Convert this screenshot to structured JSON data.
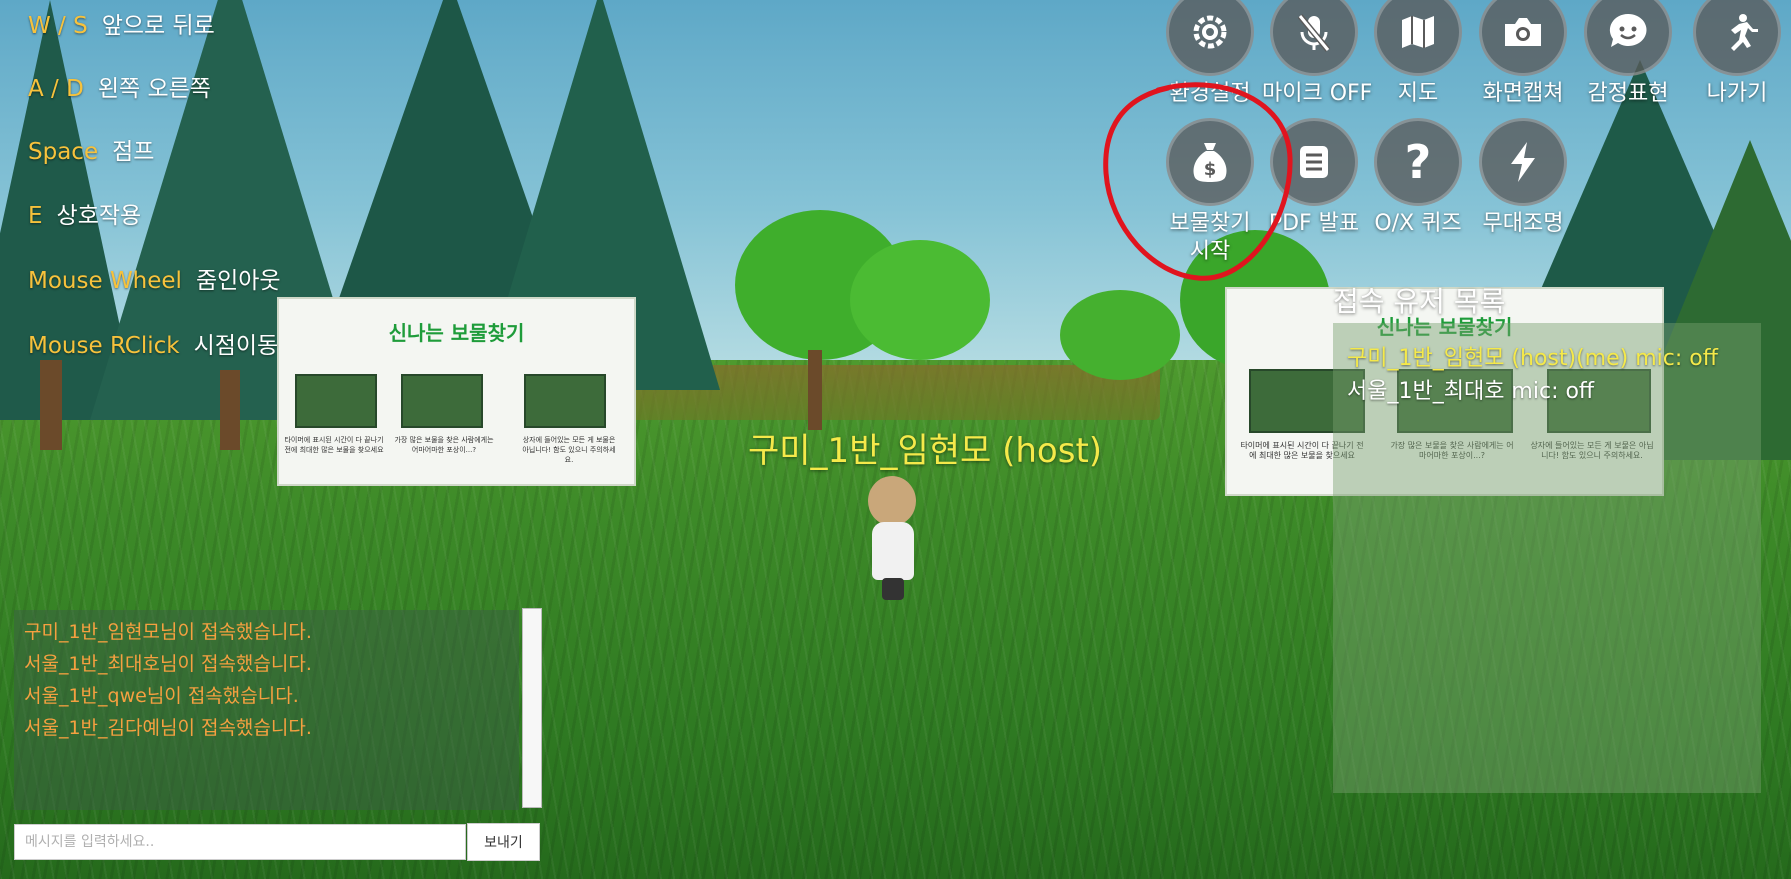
{
  "controls": [
    {
      "key": "W / S",
      "action": "앞으로 뒤로"
    },
    {
      "key": "A / D",
      "action": "왼쪽 오른쪽"
    },
    {
      "key": "Space",
      "action": "점프"
    },
    {
      "key": "E",
      "action": "상호작용"
    },
    {
      "key": "Mouse Wheel",
      "action": "줌인아웃"
    },
    {
      "key": "Mouse RClick",
      "action": "시점이동"
    }
  ],
  "toolbar": {
    "row1": [
      {
        "label": "환경설정",
        "icon": "settings-gear-icon"
      },
      {
        "label": "마이크 OFF",
        "icon": "mic-off-icon"
      },
      {
        "label": "지도",
        "icon": "map-icon"
      },
      {
        "label": "화면캡쳐",
        "icon": "camera-icon"
      },
      {
        "label": "감정표현",
        "icon": "emoji-chat-icon"
      },
      {
        "label": "나가기",
        "icon": "running-exit-icon"
      }
    ],
    "row2": [
      {
        "label": "보물찾기 시작",
        "icon": "money-bag-icon"
      },
      {
        "label": "PDF 발표",
        "icon": "document-list-icon"
      },
      {
        "label": "O/X 퀴즈",
        "icon": "question-mark-icon"
      },
      {
        "label": "무대조명",
        "icon": "lightning-icon"
      }
    ]
  },
  "scene": {
    "billboard_title": "신나는 보물찾기",
    "billboard_captions": [
      "타이머에 표시된 시간이 다 끝나기 전에 최대한 많은 보물을 찾으세요",
      "가장 많은 보물을 찾은 사람에게는 어마어마한 포상이...?",
      "상자에 들어있는 모든 게 보물은 아닙니다! 함도 있으니 주의하세요."
    ],
    "player_name": "구미_1반_임현모 (host)"
  },
  "users": {
    "title": "접속 유저 목록",
    "list": [
      {
        "text": "구미_1반_임현모 (host)(me) mic: off",
        "is_me": true
      },
      {
        "text": "서울_1반_최대호 mic: off",
        "is_me": false
      }
    ]
  },
  "chat": {
    "messages": [
      "구미_1반_임현모님이 접속했습니다.",
      "서울_1반_최대호님이 접속했습니다.",
      "서울_1반_qwe님이 접속했습니다.",
      "서울_1반_김다예님이 접속했습니다."
    ],
    "placeholder": "메시지를 입력하세요..",
    "send_label": "보내기"
  },
  "colors": {
    "key_highlight": "#f7c23c",
    "player_tag": "#f5e94a",
    "chat_text": "#f5a040",
    "annotation": "#e0141e"
  }
}
